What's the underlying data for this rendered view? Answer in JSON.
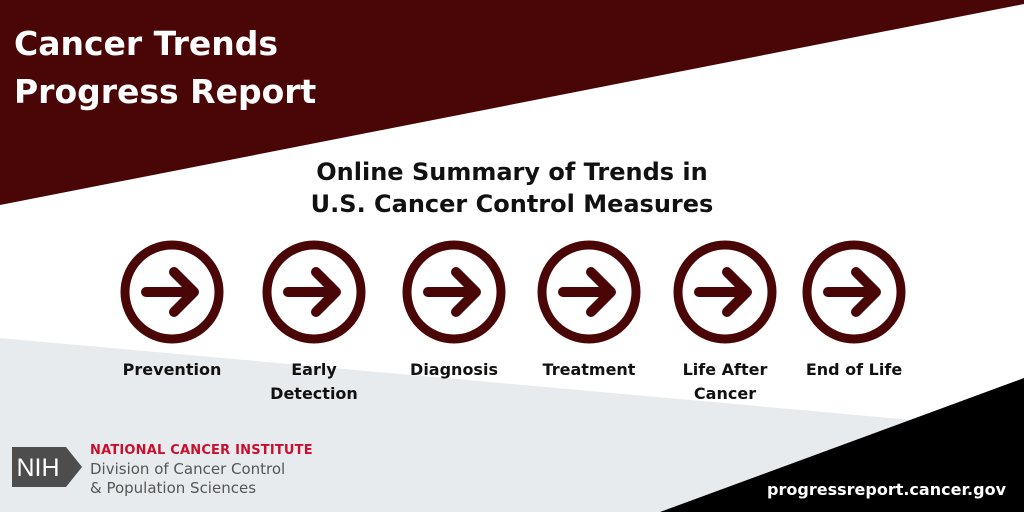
{
  "colors": {
    "maroon": "#4a0606",
    "light_gray": "#e8ebee",
    "black": "#000000",
    "nci_red": "#c8102e",
    "nih_gray": "#4d4d4d"
  },
  "header": {
    "title_line1": "Cancer Trends",
    "title_line2": "Progress Report"
  },
  "subtitle": {
    "line1": "Online Summary of Trends in",
    "line2": "U.S. Cancer Control Measures"
  },
  "stages": [
    {
      "icon": "arrow-right-circle-icon",
      "line1": "Prevention",
      "line2": ""
    },
    {
      "icon": "arrow-right-circle-icon",
      "line1": "Early",
      "line2": "Detection"
    },
    {
      "icon": "arrow-right-circle-icon",
      "line1": "Diagnosis",
      "line2": ""
    },
    {
      "icon": "arrow-right-circle-icon",
      "line1": "Treatment",
      "line2": ""
    },
    {
      "icon": "arrow-right-circle-icon",
      "line1": "Life After",
      "line2": "Cancer"
    },
    {
      "icon": "arrow-right-circle-icon",
      "line1": "End of Life",
      "line2": ""
    }
  ],
  "footer": {
    "nih_logo_text": "NIH",
    "nci_name": "NATIONAL CANCER INSTITUTE",
    "division_line1": "Division of Cancer Control",
    "division_line2": "& Population Sciences",
    "url": "progressreport.cancer.gov"
  }
}
